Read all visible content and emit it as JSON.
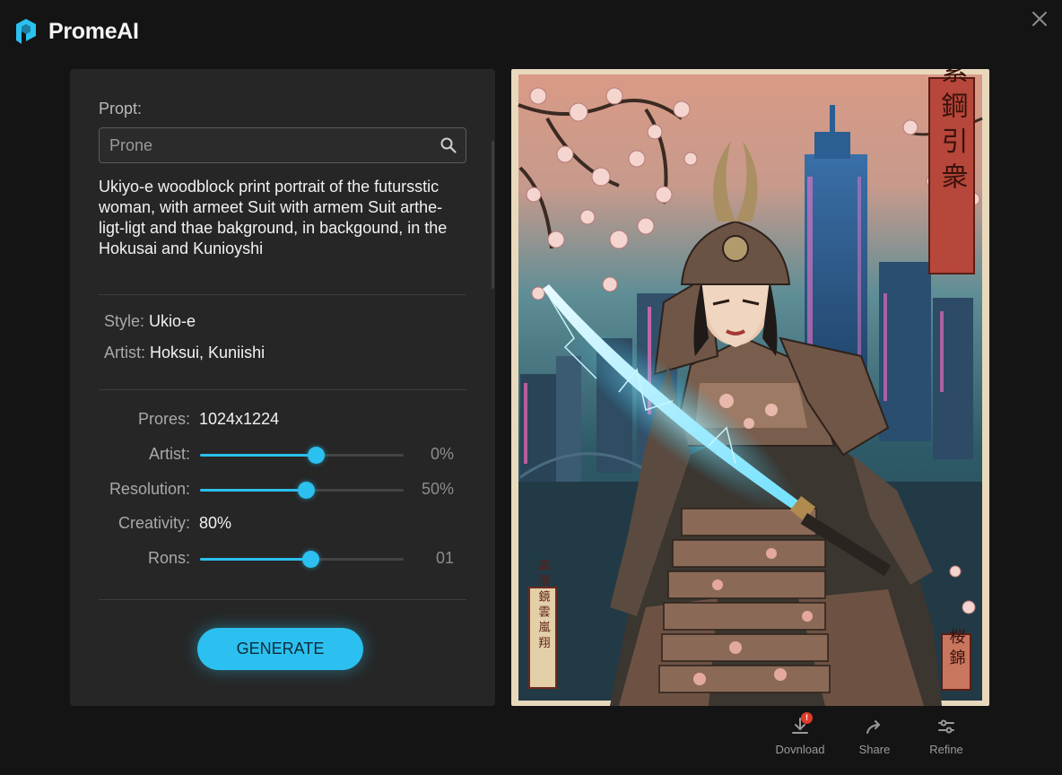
{
  "brand": {
    "name": "PromeAI",
    "accent": "#2bc0ef"
  },
  "window": {
    "close_icon": "close-icon"
  },
  "panel": {
    "prompt_label": "Propt:",
    "search": {
      "placeholder": "Prone",
      "icon": "search-icon"
    },
    "prompt_text": "Ukiyo-e woodblock print portrait of the futursstic woman, with armeet Suit with armem Suit arthe-ligt-ligt and thae bakground, in backgound, in the Hokusai and Kunioyshi",
    "style": {
      "label": "Style:",
      "value": "Ukio-e"
    },
    "artist": {
      "label": "Artist:",
      "value": "Hoksui, Kuniishi"
    },
    "settings": {
      "prores": {
        "label": "Prores:",
        "value": "1024x1224"
      },
      "artist": {
        "label": "Artist:",
        "display": "0%",
        "level": 0.57
      },
      "resolution": {
        "label": "Resolution:",
        "display": "50%",
        "level": 0.52
      },
      "creativity": {
        "label": "Creativity:",
        "value": "80%"
      },
      "rons": {
        "label": "Rons:",
        "display": "01",
        "level": 0.54
      }
    },
    "generate_label": "GENERATE"
  },
  "artwork": {
    "seal_top": "鳥 素 鋼 引 衆",
    "seal_bottom_left": "高 飛 鏡 雲 嵐 翔",
    "seal_bottom_right": "桜 錦"
  },
  "actions": {
    "download": {
      "label": "Dovnload",
      "badge": "!"
    },
    "share": {
      "label": "Share"
    },
    "refine": {
      "label": "Refine"
    }
  }
}
